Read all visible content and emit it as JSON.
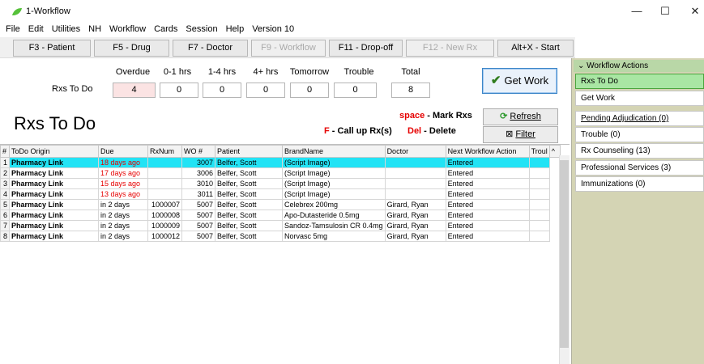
{
  "window": {
    "title": "1-Workflow",
    "minimize": "—",
    "maximize": "☐",
    "close": "✕"
  },
  "menu": [
    "File",
    "Edit",
    "Utilities",
    "NH",
    "Workflow",
    "Cards",
    "Session",
    "Help",
    "Version 10"
  ],
  "fkeys": [
    {
      "label": "F3 - Patient",
      "enabled": true
    },
    {
      "label": "F5 - Drug",
      "enabled": true
    },
    {
      "label": "F7 - Doctor",
      "enabled": true
    },
    {
      "label": "F9 - Workflow",
      "enabled": false
    },
    {
      "label": "F11 - Drop-off",
      "enabled": true
    },
    {
      "label": "F12 - New Rx",
      "enabled": false
    },
    {
      "label": "Alt+X - Start",
      "enabled": true
    }
  ],
  "summary": {
    "row_label": "Rxs To Do",
    "headers": [
      "Overdue",
      "0-1 hrs",
      "1-4 hrs",
      "4+ hrs",
      "Tomorrow",
      "Trouble",
      "Total"
    ],
    "values": [
      "4",
      "0",
      "0",
      "0",
      "0",
      "0",
      "8"
    ]
  },
  "get_work": {
    "label": "Get Work"
  },
  "page_title": "Rxs To Do",
  "hints": {
    "space_key": "space",
    "space_action": " - Mark Rxs",
    "f_key": "F",
    "f_action": " - Call up Rx(s)",
    "del_key": "Del",
    "del_action": " - Delete"
  },
  "buttons": {
    "refresh": "Refresh",
    "filter": "Filter"
  },
  "table": {
    "columns": [
      "#",
      "ToDo Origin",
      "Due",
      "RxNum",
      "WO #",
      "Patient",
      "BrandName",
      "Doctor",
      "Next Workflow Action",
      "Troul",
      "^"
    ],
    "rows": [
      {
        "n": "1",
        "origin": "Pharmacy Link",
        "due": "18 days ago",
        "rxnum": "",
        "wo": "3007",
        "patient": "Belfer, Scott",
        "brand": "(Script Image)",
        "doctor": "",
        "action": "Entered",
        "overdue": true,
        "selected": true
      },
      {
        "n": "2",
        "origin": "Pharmacy Link",
        "due": "17 days ago",
        "rxnum": "",
        "wo": "3006",
        "patient": "Belfer, Scott",
        "brand": "(Script Image)",
        "doctor": "",
        "action": "Entered",
        "overdue": true,
        "selected": false
      },
      {
        "n": "3",
        "origin": "Pharmacy Link",
        "due": "15 days ago",
        "rxnum": "",
        "wo": "3010",
        "patient": "Belfer, Scott",
        "brand": "(Script Image)",
        "doctor": "",
        "action": "Entered",
        "overdue": true,
        "selected": false
      },
      {
        "n": "4",
        "origin": "Pharmacy Link",
        "due": "13 days ago",
        "rxnum": "",
        "wo": "3011",
        "patient": "Belfer, Scott",
        "brand": "(Script Image)",
        "doctor": "",
        "action": "Entered",
        "overdue": true,
        "selected": false
      },
      {
        "n": "5",
        "origin": "Pharmacy Link",
        "due": "in 2 days",
        "rxnum": "1000007",
        "wo": "5007",
        "patient": "Belfer, Scott",
        "brand": "Celebrex 200mg",
        "doctor": "Girard, Ryan",
        "action": "Entered",
        "overdue": false,
        "selected": false
      },
      {
        "n": "6",
        "origin": "Pharmacy Link",
        "due": "in 2 days",
        "rxnum": "1000008",
        "wo": "5007",
        "patient": "Belfer, Scott",
        "brand": "Apo-Dutasteride 0.5mg",
        "doctor": "Girard, Ryan",
        "action": "Entered",
        "overdue": false,
        "selected": false
      },
      {
        "n": "7",
        "origin": "Pharmacy Link",
        "due": "in 2 days",
        "rxnum": "1000009",
        "wo": "5007",
        "patient": "Belfer, Scott",
        "brand": "Sandoz-Tamsulosin CR 0.4mg",
        "doctor": "Girard, Ryan",
        "action": "Entered",
        "overdue": false,
        "selected": false
      },
      {
        "n": "8",
        "origin": "Pharmacy Link",
        "due": "in 2 days",
        "rxnum": "1000012",
        "wo": "5007",
        "patient": "Belfer, Scott",
        "brand": "Norvasc 5mg",
        "doctor": "Girard, Ryan",
        "action": "Entered",
        "overdue": false,
        "selected": false
      }
    ]
  },
  "panel": {
    "header": "Workflow Actions",
    "items": [
      {
        "label": "Rxs To Do",
        "selected": true
      },
      {
        "label": "Get Work",
        "selected": false
      },
      {
        "label": "Pending Adjudication (0)",
        "selected": false
      },
      {
        "label": "Trouble (0)",
        "selected": false
      },
      {
        "label": "Rx Counseling (13)",
        "selected": false
      },
      {
        "label": "Professional Services (3)",
        "selected": false
      },
      {
        "label": "Immunizations (0)",
        "selected": false
      }
    ]
  },
  "colors": {
    "selected_row": "#22e3f5",
    "overdue_text": "#e60000",
    "panel_bg": "#d4d4b4",
    "selected_panel_item": "#a9e6a3"
  }
}
